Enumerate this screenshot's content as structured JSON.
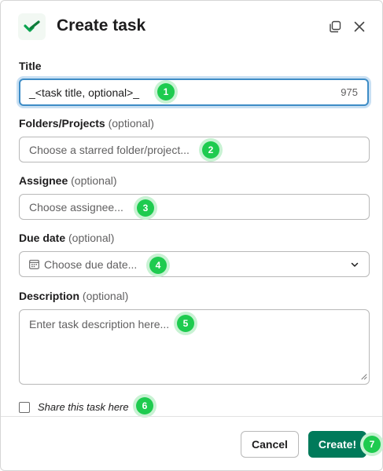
{
  "header": {
    "title": "Create task",
    "logo_icon": "check-logo-icon",
    "expand_icon": "window-expand-icon",
    "close_icon": "close-icon"
  },
  "title_field": {
    "label": "Title",
    "value": "_<task title, optional>_",
    "counter": "975",
    "badge": "1"
  },
  "folders_field": {
    "label": "Folders/Projects",
    "optional": "(optional)",
    "placeholder": "Choose a starred folder/project...",
    "badge": "2"
  },
  "assignee_field": {
    "label": "Assignee",
    "optional": "(optional)",
    "placeholder": "Choose assignee...",
    "badge": "3"
  },
  "due_date_field": {
    "label": "Due date",
    "optional": "(optional)",
    "placeholder": "Choose due date...",
    "badge": "4"
  },
  "description_field": {
    "label": "Description",
    "optional": "(optional)",
    "placeholder": "Enter task description here...",
    "badge": "5"
  },
  "share": {
    "label": "Share this task here",
    "checked": false,
    "badge": "6"
  },
  "footer": {
    "cancel_label": "Cancel",
    "create_label": "Create!",
    "badge": "7"
  },
  "colors": {
    "brand_green": "#007a5a",
    "badge_green": "#1ecb4f",
    "focus_blue": "#3d8cc6"
  }
}
